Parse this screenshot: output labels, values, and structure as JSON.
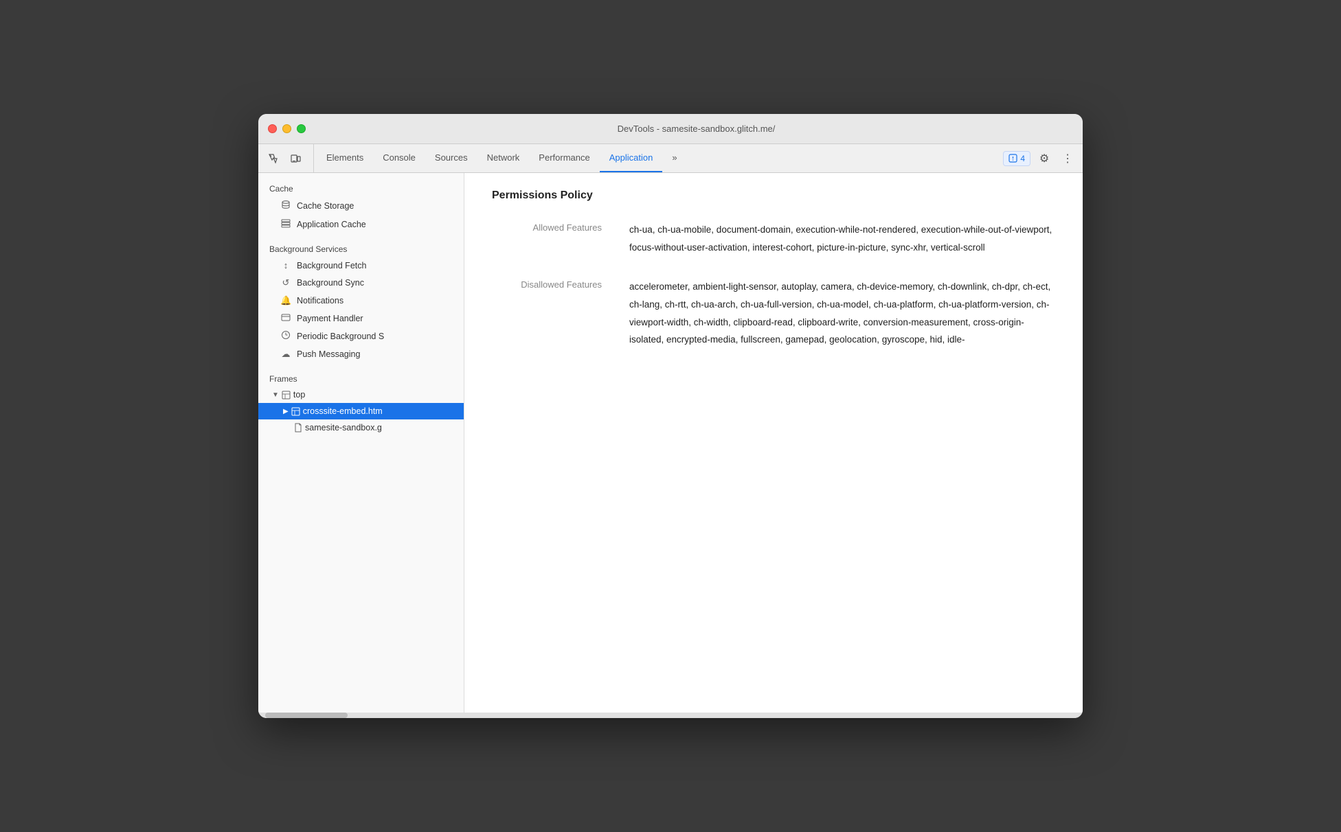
{
  "window": {
    "title": "DevTools - samesite-sandbox.glitch.me/"
  },
  "toolbar": {
    "tabs": [
      {
        "id": "elements",
        "label": "Elements",
        "active": false
      },
      {
        "id": "console",
        "label": "Console",
        "active": false
      },
      {
        "id": "sources",
        "label": "Sources",
        "active": false
      },
      {
        "id": "network",
        "label": "Network",
        "active": false
      },
      {
        "id": "performance",
        "label": "Performance",
        "active": false
      },
      {
        "id": "application",
        "label": "Application",
        "active": true
      },
      {
        "id": "more",
        "label": "»",
        "active": false
      }
    ],
    "badge_count": "4",
    "settings_icon": "⚙",
    "more_icon": "⋮"
  },
  "sidebar": {
    "cache_section": "Cache",
    "cache_storage_label": "Cache Storage",
    "application_cache_label": "Application Cache",
    "background_services_section": "Background Services",
    "background_fetch_label": "Background Fetch",
    "background_sync_label": "Background Sync",
    "notifications_label": "Notifications",
    "payment_handler_label": "Payment Handler",
    "periodic_background_label": "Periodic Background S",
    "push_messaging_label": "Push Messaging",
    "frames_section": "Frames",
    "top_label": "top",
    "crosssite_label": "crosssite-embed.htm",
    "samesite_label": "samesite-sandbox.g"
  },
  "content": {
    "title": "Permissions Policy",
    "allowed_features_label": "Allowed Features",
    "allowed_features_value": "ch-ua, ch-ua-mobile, document-domain, execution-while-not-rendered, execution-while-out-of-viewport, focus-without-user-activation, interest-cohort, picture-in-picture, sync-xhr, vertical-scroll",
    "disallowed_features_label": "Disallowed Features",
    "disallowed_features_value": "accelerometer, ambient-light-sensor, autoplay, camera, ch-device-memory, ch-downlink, ch-dpr, ch-ect, ch-lang, ch-rtt, ch-ua-arch, ch-ua-full-version, ch-ua-model, ch-ua-platform, ch-ua-platform-version, ch-viewport-width, ch-width, clipboard-read, clipboard-write, conversion-measurement, cross-origin-isolated, encrypted-media, fullscreen, gamepad, geolocation, gyroscope, hid, idle-"
  }
}
